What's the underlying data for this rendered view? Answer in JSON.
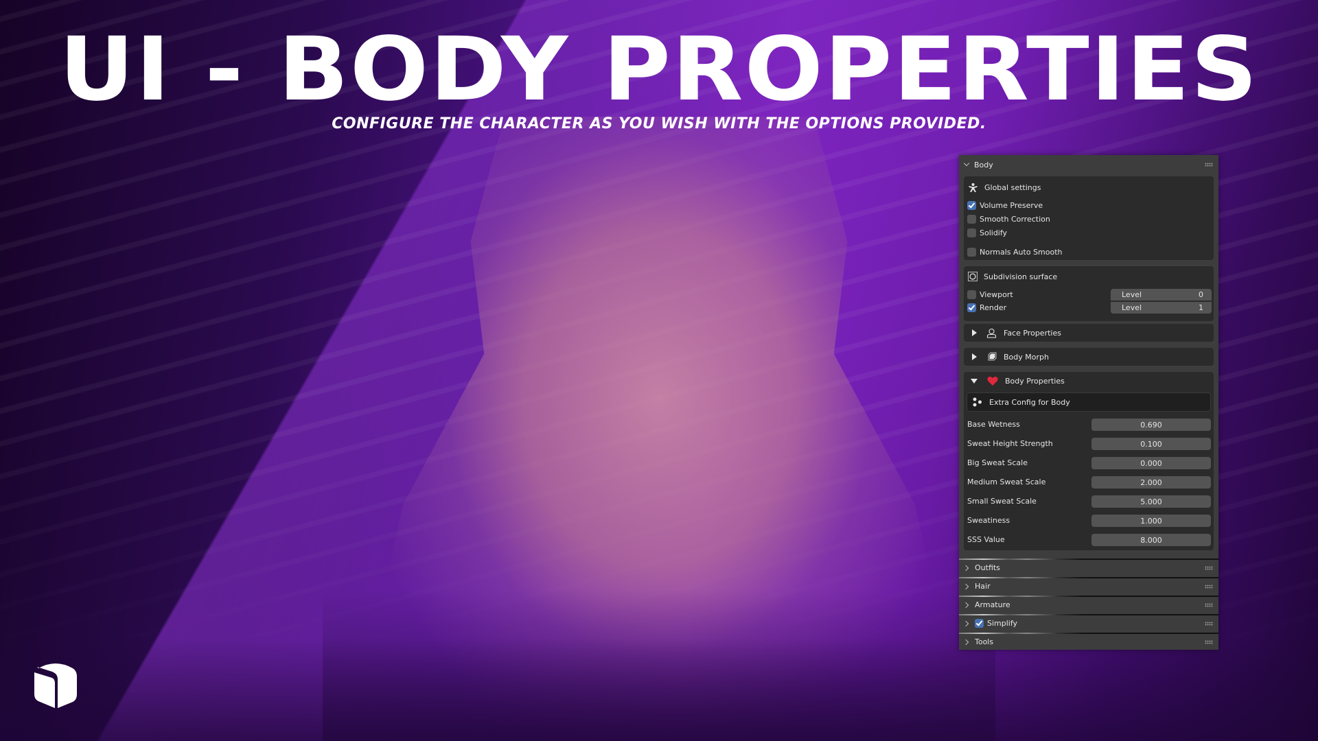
{
  "banner": {
    "title": "UI - BODY PROPERTIES",
    "subtitle": "CONFIGURE THE CHARACTER AS YOU WISH WITH THE OPTIONS PROVIDED.",
    "logo_icon": "cube-icon"
  },
  "colors": {
    "accent_purple": "#7a20b8",
    "checkbox_on": "#4772b3",
    "heart": "#e0283c",
    "panel_bg": "#3d3d3d",
    "box_bg": "#2b2b2b",
    "field_bg": "#545454"
  },
  "panel": {
    "title": "Body",
    "global_settings": {
      "title": "Global settings",
      "icon": "armature-figure-icon",
      "options": [
        {
          "label": "Volume Preserve",
          "checked": true
        },
        {
          "label": "Smooth Correction",
          "checked": false
        },
        {
          "label": "Solidify",
          "checked": false
        },
        {
          "label": "Normals Auto Smooth",
          "checked": false
        }
      ]
    },
    "subdivision": {
      "title": "Subdivision surface",
      "icon": "subdivision-circle-icon",
      "rows": [
        {
          "label": "Viewport",
          "checked": false,
          "field_label": "Level",
          "value": "0"
        },
        {
          "label": "Render",
          "checked": true,
          "field_label": "Level",
          "value": "1"
        }
      ]
    },
    "face_properties": {
      "title": "Face Properties",
      "icon": "user-outline-icon",
      "expanded": false
    },
    "body_morph": {
      "title": "Body Morph",
      "icon": "shape-key-icon",
      "expanded": false
    },
    "body_properties": {
      "title": "Body Properties",
      "icon": "heart-icon",
      "expanded": true,
      "extra_config": {
        "title": "Extra Config for Body",
        "icon": "node-dots-icon"
      },
      "fields": [
        {
          "label": "Base Wetness",
          "value": "0.690"
        },
        {
          "label": "Sweat Height Strength",
          "value": "0.100"
        },
        {
          "label": "Big Sweat Scale",
          "value": "0.000"
        },
        {
          "label": "Medium Sweat Scale",
          "value": "2.000"
        },
        {
          "label": "Small Sweat Scale",
          "value": "5.000"
        },
        {
          "label": "Sweatiness",
          "value": "1.000"
        },
        {
          "label": "SSS Value",
          "value": "8.000"
        }
      ]
    },
    "collapsed_panels": [
      {
        "label": "Outfits",
        "has_checkbox": false
      },
      {
        "label": "Hair",
        "has_checkbox": false
      },
      {
        "label": "Armature",
        "has_checkbox": false
      },
      {
        "label": "Simplify",
        "has_checkbox": true,
        "checked": true
      },
      {
        "label": "Tools",
        "has_checkbox": false
      }
    ]
  }
}
